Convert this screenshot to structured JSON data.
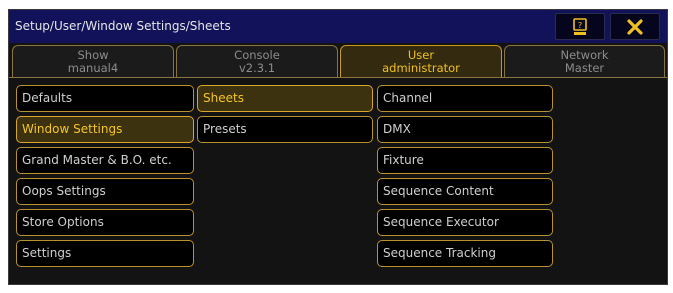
{
  "window": {
    "title": "Setup/User/Window Settings/Sheets"
  },
  "titlebar_buttons": {
    "help_icon": "keyboard-help-icon",
    "close_icon": "close-x-icon"
  },
  "colors": {
    "titlebar": "#12125a",
    "accent": "#f0c020",
    "selected_bg": "#3d320f",
    "border": "#b8922e"
  },
  "tabs": [
    {
      "line1": "Show",
      "line2": "manual4",
      "active": false
    },
    {
      "line1": "Console",
      "line2": "v2.3.1",
      "active": false
    },
    {
      "line1": "User",
      "line2": "administrator",
      "active": true
    },
    {
      "line1": "Network",
      "line2": "Master",
      "active": false
    }
  ],
  "column1": [
    {
      "label": "Defaults",
      "selected": false
    },
    {
      "label": "Window Settings",
      "selected": true
    },
    {
      "label": "Grand Master & B.O. etc.",
      "selected": false
    },
    {
      "label": "Oops Settings",
      "selected": false
    },
    {
      "label": "Store Options",
      "selected": false
    },
    {
      "label": "Settings",
      "selected": false
    }
  ],
  "column2": [
    {
      "label": "Sheets",
      "selected": true
    },
    {
      "label": "Presets",
      "selected": false
    }
  ],
  "column3": [
    {
      "label": "Channel",
      "selected": false
    },
    {
      "label": "DMX",
      "selected": false
    },
    {
      "label": "Fixture",
      "selected": false
    },
    {
      "label": "Sequence Content",
      "selected": false
    },
    {
      "label": "Sequence Executor",
      "selected": false
    },
    {
      "label": "Sequence Tracking",
      "selected": false
    }
  ]
}
